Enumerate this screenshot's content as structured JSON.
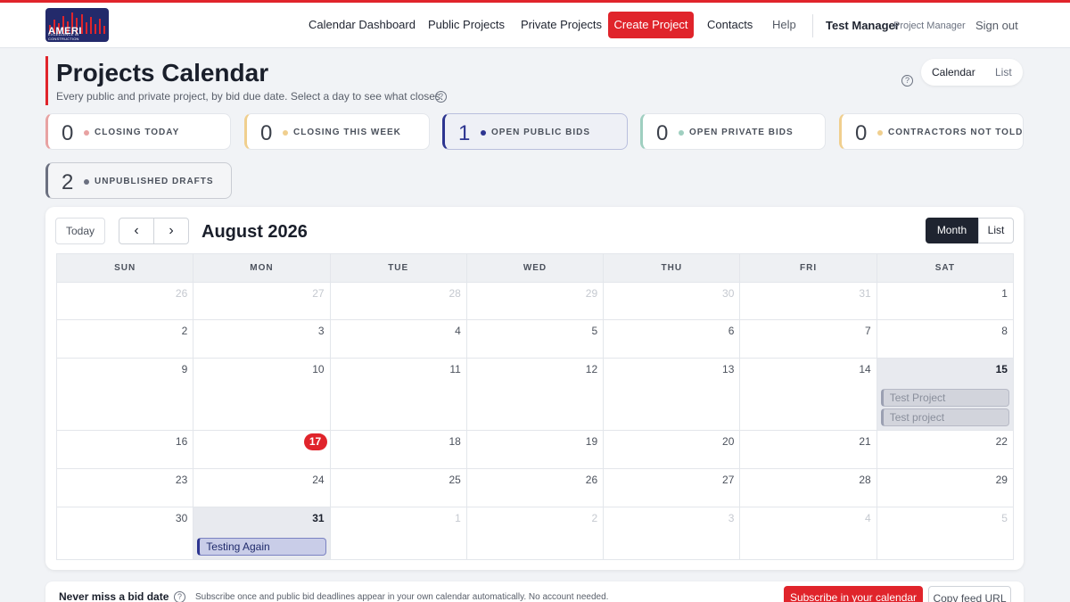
{
  "brand": {
    "logo_word": "AMERI",
    "logo_tagline": "EXCELLENCE IN CONSTRUCTION",
    "accent": "#e0242b",
    "navy": "#232a6b"
  },
  "nav": {
    "calendar_dashboard": "Calendar Dashboard",
    "public_projects": "Public Projects",
    "private_projects": "Private Projects",
    "create_project": "Create Project",
    "contacts": "Contacts",
    "help": "Help",
    "user_name": "Test Manager",
    "user_role": "Project Manager",
    "sign_out": "Sign out"
  },
  "page": {
    "title": "Projects Calendar",
    "subtitle": "Every public and private project, by bid due date. Select a day to see what closes.",
    "help_icon": "question-circle-icon",
    "view_options": [
      "Calendar",
      "List"
    ],
    "active_view": "Calendar"
  },
  "stats": [
    {
      "count": "0",
      "label": "CLOSING TODAY",
      "color": "#e8a2a2"
    },
    {
      "count": "0",
      "label": "CLOSING THIS WEEK",
      "color": "#f0cf8e"
    },
    {
      "count": "1",
      "label": "OPEN PUBLIC BIDS",
      "color": "#2d3590"
    },
    {
      "count": "0",
      "label": "OPEN PRIVATE BIDS",
      "color": "#9fcfc0"
    },
    {
      "count": "0",
      "label": "CONTRACTORS NOT TOLD",
      "color": "#f0cf8e"
    },
    {
      "count": "2",
      "label": "UNPUBLISHED DRAFTS",
      "color": "#6b7080"
    }
  ],
  "calendar": {
    "today_label": "Today",
    "prev_icon": "chevron-left-icon",
    "next_icon": "chevron-right-icon",
    "month_title": "August 2026",
    "view_modes": [
      "Month",
      "List"
    ],
    "active_mode": "Month",
    "weekdays": [
      "SUN",
      "MON",
      "TUE",
      "WED",
      "THU",
      "FRI",
      "SAT"
    ],
    "weeks": [
      [
        {
          "d": "26",
          "m": true
        },
        {
          "d": "27",
          "m": true
        },
        {
          "d": "28",
          "m": true
        },
        {
          "d": "29",
          "m": true
        },
        {
          "d": "30",
          "m": true
        },
        {
          "d": "31",
          "m": true
        },
        {
          "d": "1"
        }
      ],
      [
        {
          "d": "2"
        },
        {
          "d": "3"
        },
        {
          "d": "4"
        },
        {
          "d": "5"
        },
        {
          "d": "6"
        },
        {
          "d": "7"
        },
        {
          "d": "8"
        }
      ],
      [
        {
          "d": "9"
        },
        {
          "d": "10"
        },
        {
          "d": "11"
        },
        {
          "d": "12"
        },
        {
          "d": "13"
        },
        {
          "d": "14"
        },
        {
          "d": "15",
          "hl": true,
          "events": [
            {
              "title": "Test Project",
              "kind": "draft"
            },
            {
              "title": "Test project",
              "kind": "draft"
            }
          ]
        }
      ],
      [
        {
          "d": "16"
        },
        {
          "d": "17",
          "today": true
        },
        {
          "d": "18"
        },
        {
          "d": "19"
        },
        {
          "d": "20"
        },
        {
          "d": "21"
        },
        {
          "d": "22"
        }
      ],
      [
        {
          "d": "23"
        },
        {
          "d": "24"
        },
        {
          "d": "25"
        },
        {
          "d": "26"
        },
        {
          "d": "27"
        },
        {
          "d": "28"
        },
        {
          "d": "29"
        }
      ],
      [
        {
          "d": "30"
        },
        {
          "d": "31",
          "hl": true,
          "events": [
            {
              "title": "Testing Again",
              "kind": "pub"
            }
          ]
        },
        {
          "d": "1",
          "m": true
        },
        {
          "d": "2",
          "m": true
        },
        {
          "d": "3",
          "m": true
        },
        {
          "d": "4",
          "m": true
        },
        {
          "d": "5",
          "m": true
        }
      ]
    ]
  },
  "footer": {
    "title": "Never miss a bid date",
    "text": "Subscribe once and public bid deadlines appear in your own calendar automatically. No account needed.",
    "subscribe": "Subscribe in your calendar",
    "copy": "Copy feed URL"
  }
}
